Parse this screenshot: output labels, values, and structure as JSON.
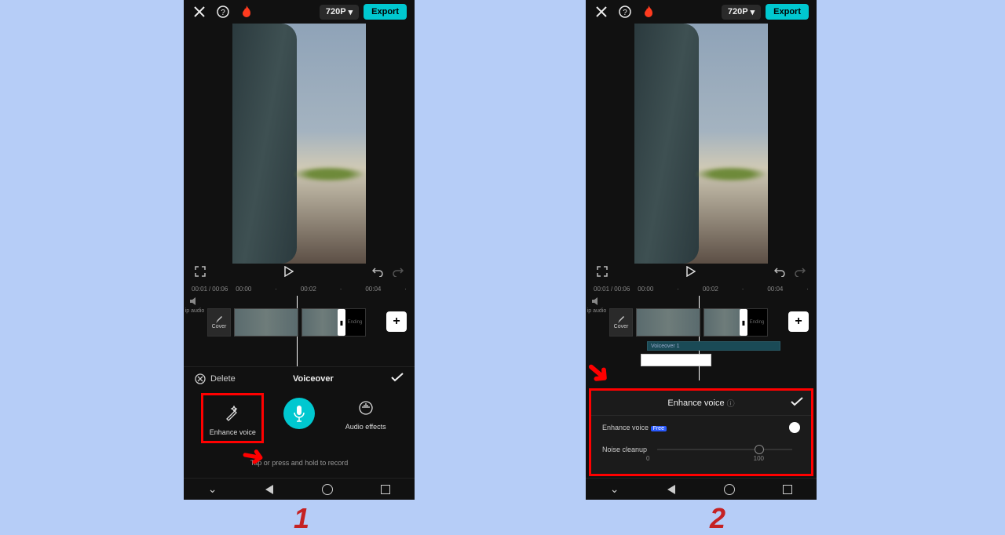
{
  "topbar": {
    "resolution": "720P",
    "export": "Export"
  },
  "controls": {
    "current": "00:01",
    "total": "00:06"
  },
  "timeline": {
    "ticks": [
      "00:00",
      "·",
      "00:02",
      "·",
      "00:04",
      "·"
    ],
    "cover": "Cover",
    "audioLabel": "ip audio",
    "ending": "Ending",
    "voicetrack": "Voiceover 1"
  },
  "phone1": {
    "panelTitle": "Voiceover",
    "delete": "Delete",
    "enhance": "Enhance voice",
    "audiofx": "Audio effects",
    "hint": "Tap or press and hold to record"
  },
  "phone2": {
    "title": "Enhance voice",
    "row1": "Enhance voice",
    "badge": "Free",
    "row2": "Noise cleanup",
    "scaleMin": "0",
    "scaleMax": "100"
  },
  "steps": {
    "one": "1",
    "two": "2"
  }
}
